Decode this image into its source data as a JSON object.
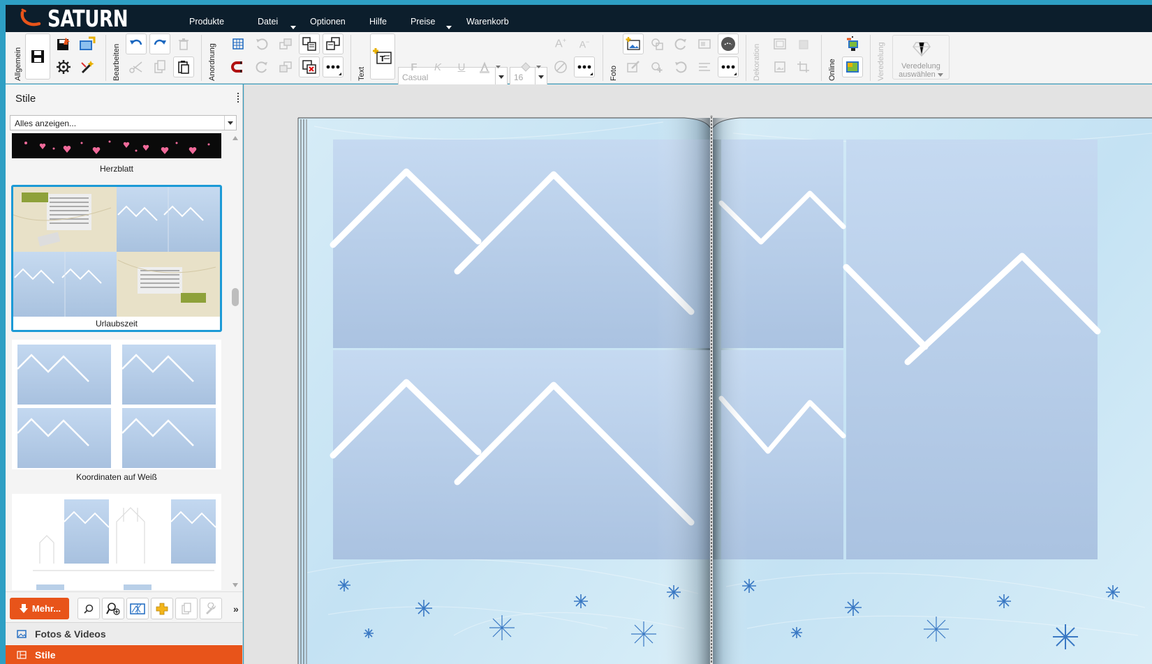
{
  "header": {
    "logo_text": "SATURN",
    "menu": [
      {
        "label": "Produkte",
        "has_caret": false
      },
      {
        "label": "Datei",
        "has_caret": true
      },
      {
        "label": "Optionen",
        "has_caret": false
      },
      {
        "label": "Hilfe",
        "has_caret": false
      },
      {
        "label": "Preise",
        "has_caret": true
      },
      {
        "label": "Warenkorb",
        "has_caret": false
      }
    ]
  },
  "toolbar": {
    "groups": {
      "allgemein": "Allgemein",
      "bearbeiten": "Bearbeiten",
      "anordnung": "Anordnung",
      "text": "Text",
      "foto": "Foto",
      "dekoration": "Dekoration",
      "online": "Online",
      "veredelung": "Veredelung"
    },
    "font_family": "Casual",
    "font_size": "16",
    "veredelung_button_line1": "Veredelung",
    "veredelung_button_line2": "auswählen"
  },
  "panel": {
    "title": "Stile",
    "filter_value": "Alles anzeigen...",
    "styles": [
      {
        "name": "Herzblatt",
        "selected": false
      },
      {
        "name": "Urlaubszeit",
        "selected": true
      },
      {
        "name": "Koordinaten auf Weiß",
        "selected": false
      },
      {
        "name": "",
        "selected": false
      }
    ],
    "mehr_label": "Mehr...",
    "nav": [
      {
        "label": "Fotos & Videos",
        "active": false
      },
      {
        "label": "Stile",
        "active": true
      }
    ]
  },
  "colors": {
    "accent_orange": "#e8541a",
    "header_bg": "#0c1e2c",
    "selection_blue": "#1c9ad6",
    "frame_blue": "#2e9fc4"
  }
}
